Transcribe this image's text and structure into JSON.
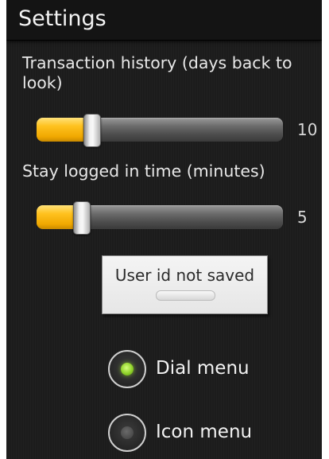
{
  "header": {
    "title": "Settings"
  },
  "settings": {
    "transaction_history": {
      "label": "Transaction history (days back to look)",
      "value": "10",
      "fill_fraction": 0.1
    },
    "stay_logged_in": {
      "label": "Stay logged in time (minutes)",
      "value": "5",
      "fill_fraction": 0.05
    }
  },
  "user_id_toggle": {
    "label": "User id not saved",
    "checked": false
  },
  "menu_style": {
    "options": [
      {
        "label": "Dial menu",
        "selected": true
      },
      {
        "label": "Icon menu",
        "selected": false
      }
    ]
  },
  "colors": {
    "slider_fill": "#ffc21f",
    "radio_selected": "#8fd12a",
    "background": "#1c1c1c"
  }
}
